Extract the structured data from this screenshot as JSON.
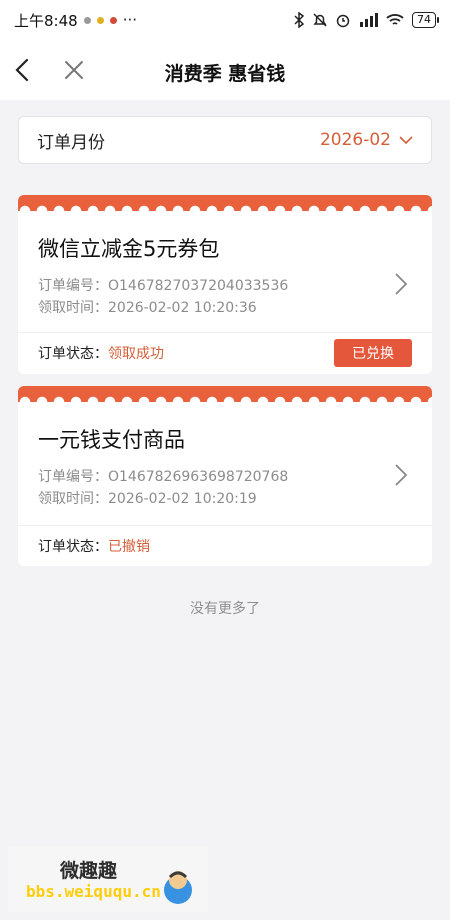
{
  "status_bar": {
    "time": "上午8:48",
    "more": "···",
    "battery": "74"
  },
  "nav": {
    "title": "消费季 惠省钱"
  },
  "filter": {
    "label": "订单月份",
    "value": "2026-02"
  },
  "orders": [
    {
      "title": "微信立减金5元券包",
      "order_no_label": "订单编号：",
      "order_no": "O1467827037204033536",
      "time_label": "领取时间：",
      "time": "2026-02-02 10:20:36",
      "status_label": "订单状态：",
      "status": "领取成功",
      "button": "已兑换"
    },
    {
      "title": "一元钱支付商品",
      "order_no_label": "订单编号：",
      "order_no": "O1467826963698720768",
      "time_label": "领取时间：",
      "time": "2026-02-02 10:20:19",
      "status_label": "订单状态：",
      "status": "已撤销"
    }
  ],
  "footer": {
    "no_more": "没有更多了"
  },
  "watermark": {
    "title": "微趣趣",
    "url": "bbs.weiququ.cn"
  }
}
